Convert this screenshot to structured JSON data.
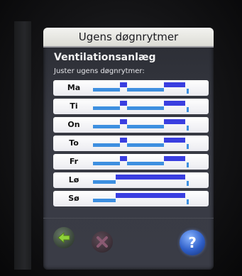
{
  "header": {
    "title": "Ugens døgnrytmer"
  },
  "section": {
    "heading": "Ventilationsanlæg",
    "instruction": "Juster ugens døgnrytmer:"
  },
  "days": [
    {
      "label": "Ma"
    },
    {
      "label": "Ti"
    },
    {
      "label": "On"
    },
    {
      "label": "To"
    },
    {
      "label": "Fr"
    },
    {
      "label": "Lø"
    },
    {
      "label": "Sø"
    }
  ],
  "toolbar": {
    "back_icon": "arrow-left-icon",
    "cancel_icon": "close-icon",
    "help_icon": "question-icon",
    "help_glyph": "?"
  },
  "colors": {
    "schedule_low": "#3d8fe0",
    "schedule_high": "#3a3ee0",
    "row_bg": "#f2f2f5",
    "help_accent": "#2f5fc8"
  }
}
